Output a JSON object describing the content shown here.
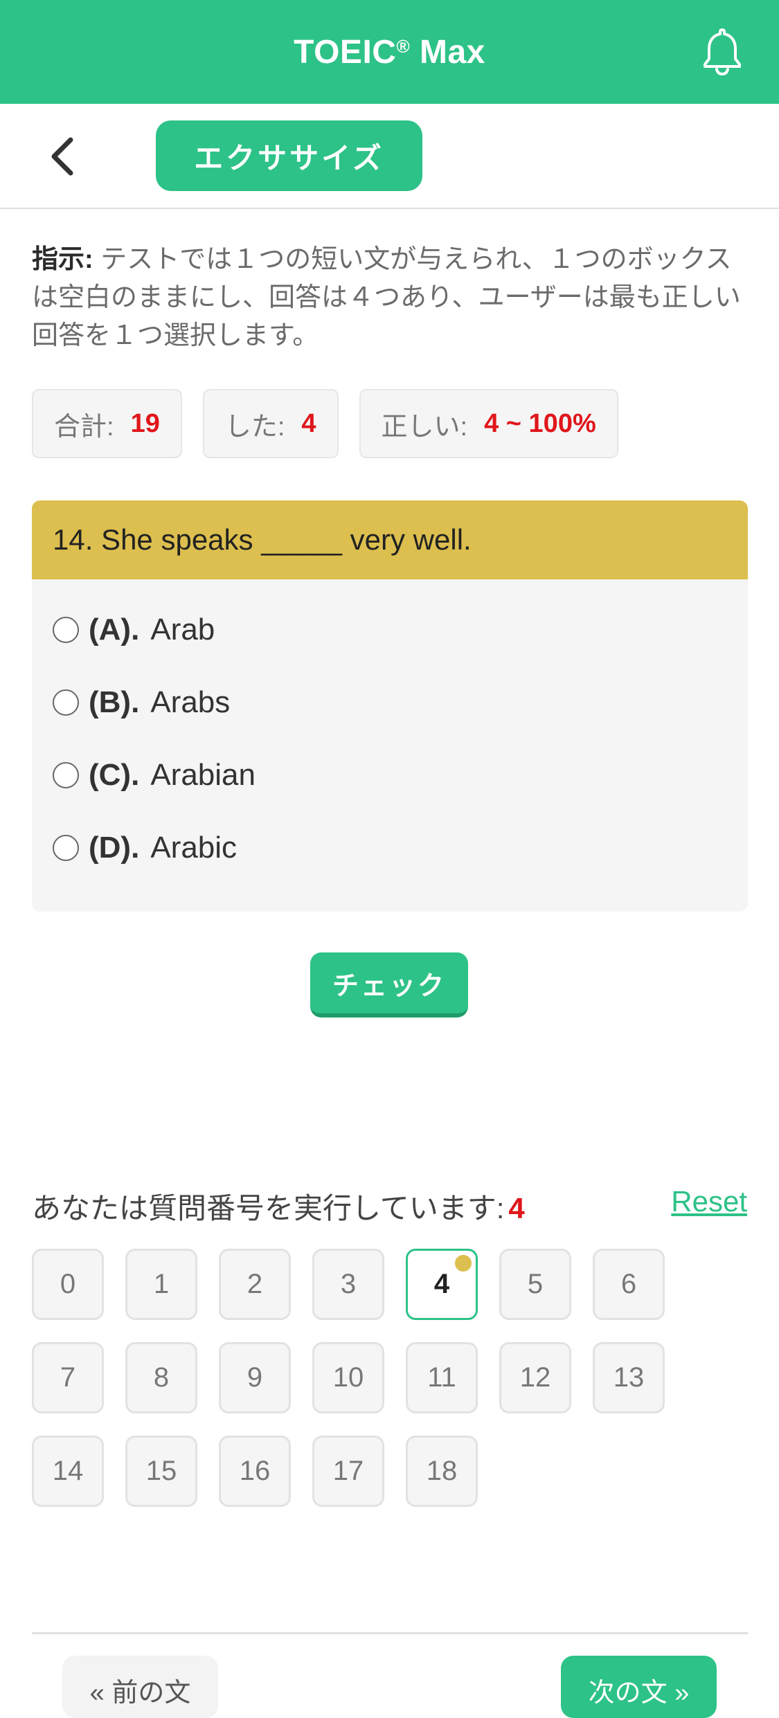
{
  "header": {
    "title": "TOEIC",
    "title_reg": "®",
    "title_suffix": "Max",
    "bell_icon": "bell-icon",
    "bg_color": "#2dc287"
  },
  "subbar": {
    "back_icon": "chevron-left-icon",
    "exercise_label": "エクササイズ"
  },
  "instructions": {
    "label": "指示:",
    "text": "テストでは１つの短い文が与えられ、１つのボックスは空白のままにし、回答は４つあり、ユーザーは最も正しい回答を１つ選択します。"
  },
  "stats": {
    "total_label": "合計:",
    "total_value": "19",
    "done_label": "した:",
    "done_value": "4",
    "correct_label": "正しい:",
    "correct_value": "4 ~ 100%"
  },
  "question": {
    "text": "14. She speaks _____ very well.",
    "options": [
      {
        "letter": "(A).",
        "text": "Arab"
      },
      {
        "letter": "(B).",
        "text": "Arabs"
      },
      {
        "letter": "(C).",
        "text": "Arabian"
      },
      {
        "letter": "(D).",
        "text": "Arabic"
      }
    ]
  },
  "check_label": "チェック",
  "progress": {
    "label": "あなたは質問番号を実行しています:",
    "current": "4",
    "reset_label": "Reset"
  },
  "grid": {
    "numbers": [
      "0",
      "1",
      "2",
      "3",
      "4",
      "5",
      "6",
      "7",
      "8",
      "9",
      "10",
      "11",
      "12",
      "13",
      "14",
      "15",
      "16",
      "17",
      "18"
    ],
    "active": "4"
  },
  "nav": {
    "prev_label": "« 前の文",
    "next_label": "次の文 »"
  }
}
